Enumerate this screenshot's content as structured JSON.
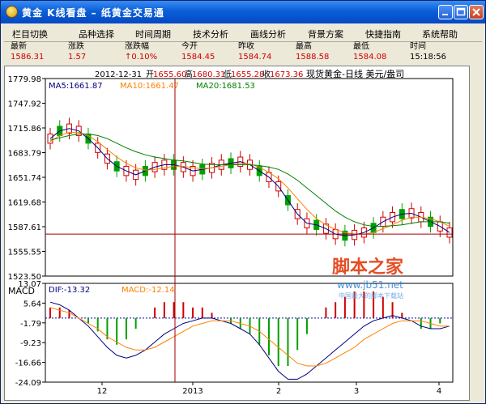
{
  "titlebar": {
    "title": "黄金  K线看盘  –  纸黄金交易通"
  },
  "menu": [
    "栏目切换",
    "品种选择",
    "时间周期",
    "技术分析",
    "画线分析",
    "背景方案",
    "快捷指南",
    "系统帮助"
  ],
  "quotes": [
    {
      "label": "最新",
      "value": "1586.31",
      "color": "#d00000"
    },
    {
      "label": "涨跌",
      "value": "1.57",
      "color": "#d00000"
    },
    {
      "label": "涨跌幅",
      "value": "↑0.10%",
      "color": "#d00000"
    },
    {
      "label": "今开",
      "value": "1584.45",
      "color": "#d00000"
    },
    {
      "label": "昨收",
      "value": "1584.74",
      "color": "#d00000"
    },
    {
      "label": "最高",
      "value": "1588.58",
      "color": "#d00000"
    },
    {
      "label": "最低",
      "value": "1584.08",
      "color": "#d00000"
    },
    {
      "label": "时间",
      "value": "15:18:56",
      "color": "#000000"
    }
  ],
  "chart_header": {
    "date": "2012-12-31",
    "open_label": "开",
    "open": "1655.60",
    "high_label": "高",
    "high": "1680.31",
    "low_label": "低",
    "low": "1655.28",
    "close_label": "收",
    "close": "1673.36",
    "instrument": "现货黄金-日线 美元/盎司"
  },
  "ma_labels": {
    "ma5": "MA5:1661.87",
    "ma10": "MA10:1661.47",
    "ma20": "MA20:1681.53"
  },
  "macd_labels": {
    "title": "MACD",
    "dif": "DIF:-13.32",
    "macd": "MACD:-12.14"
  },
  "watermark": {
    "main": "脚本之家",
    "sub": "www.jb51.net",
    "sub2": "中国最大的脚本下载站"
  },
  "colors": {
    "up": "#d00000",
    "down": "#00a000",
    "ma5": "#000080",
    "ma10": "#ff8000",
    "ma20": "#008000",
    "crosshair": "#a00000",
    "dif": "#000080",
    "macd": "#ff8000"
  },
  "chart_data": [
    {
      "type": "candlestick",
      "title": "现货黄金-日线 美元/盎司",
      "y_ticks": [
        1779.98,
        1747.92,
        1715.86,
        1683.79,
        1651.74,
        1619.68,
        1587.61,
        1555.55,
        1523.5
      ],
      "ylim": [
        1523.5,
        1779.98
      ],
      "x_ticks": [
        "12",
        "2013",
        "2",
        "3",
        "4"
      ],
      "series": [
        {
          "name": "MA5",
          "approx_values": [
            1702,
            1712,
            1715,
            1712,
            1702,
            1690,
            1676,
            1666,
            1660,
            1655,
            1660,
            1665,
            1668,
            1668,
            1665,
            1660,
            1662,
            1664,
            1668,
            1670,
            1672,
            1668,
            1660,
            1652,
            1640,
            1622,
            1604,
            1592,
            1590,
            1585,
            1578,
            1576,
            1577,
            1580,
            1586,
            1594,
            1600,
            1604,
            1605,
            1600,
            1594,
            1588,
            1580
          ]
        },
        {
          "name": "MA10",
          "approx_values": [
            1698,
            1706,
            1710,
            1710,
            1706,
            1698,
            1688,
            1678,
            1670,
            1664,
            1661,
            1662,
            1664,
            1666,
            1666,
            1664,
            1663,
            1664,
            1666,
            1668,
            1670,
            1669,
            1665,
            1658,
            1650,
            1638,
            1624,
            1610,
            1598,
            1590,
            1584,
            1580,
            1578,
            1578,
            1580,
            1585,
            1590,
            1596,
            1600,
            1600,
            1598,
            1594,
            1588
          ]
        },
        {
          "name": "MA20",
          "approx_values": [
            1700,
            1703,
            1706,
            1708,
            1708,
            1706,
            1702,
            1696,
            1690,
            1685,
            1681,
            1678,
            1676,
            1674,
            1673,
            1671,
            1669,
            1668,
            1668,
            1668,
            1668,
            1668,
            1667,
            1665,
            1662,
            1656,
            1648,
            1638,
            1628,
            1618,
            1608,
            1600,
            1594,
            1590,
            1588,
            1588,
            1589,
            1590,
            1592,
            1594,
            1594,
            1594,
            1592
          ]
        }
      ],
      "crosshair": {
        "date": "2012-12-31",
        "price": 1578.0
      }
    },
    {
      "type": "bar",
      "title": "MACD",
      "y_ticks": [
        13.07,
        5.64,
        -1.79,
        -9.23,
        -16.66,
        -24.09
      ],
      "ylim": [
        -24.09,
        13.07
      ],
      "series": [
        {
          "name": "DIF",
          "approx_values": [
            6,
            5,
            3,
            0,
            -3,
            -7,
            -11,
            -14,
            -15,
            -14,
            -12,
            -9,
            -6,
            -4,
            -2,
            -1,
            0,
            0,
            -1,
            -2,
            -4,
            -6,
            -10,
            -15,
            -20,
            -23,
            -23,
            -21,
            -18,
            -15,
            -12,
            -9,
            -6,
            -3,
            -1,
            0,
            1,
            0,
            -1,
            -3,
            -4,
            -4,
            -3
          ]
        },
        {
          "name": "MACD",
          "approx_values": [
            4,
            3,
            2,
            0,
            -2,
            -4,
            -7,
            -9,
            -11,
            -12,
            -12,
            -11,
            -9,
            -7,
            -5,
            -3,
            -2,
            -1,
            -1,
            -1,
            -2,
            -3,
            -5,
            -8,
            -11,
            -14,
            -17,
            -18,
            -18,
            -17,
            -15,
            -13,
            -11,
            -8,
            -6,
            -4,
            -2,
            -1,
            -1,
            -1,
            -2,
            -3,
            -3
          ]
        },
        {
          "name": "histogram",
          "approx_values": [
            4,
            4,
            3,
            0,
            -2,
            -5,
            -8,
            -10,
            -8,
            -4,
            0,
            4,
            6,
            6,
            6,
            4,
            4,
            2,
            0,
            -2,
            -4,
            -6,
            -10,
            -14,
            -18,
            -18,
            -12,
            -6,
            0,
            4,
            6,
            8,
            10,
            10,
            10,
            8,
            6,
            2,
            0,
            -4,
            -4,
            -2,
            0
          ]
        }
      ]
    }
  ]
}
